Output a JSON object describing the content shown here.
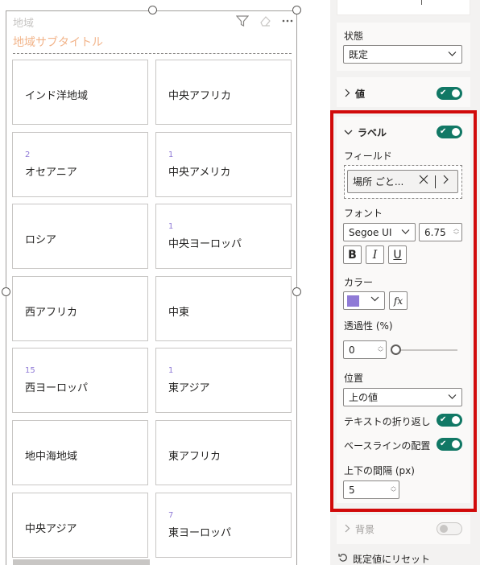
{
  "visual": {
    "title": "地域",
    "subtitle": "地域サブタイトル",
    "icons": [
      "filter-icon",
      "eraser-icon",
      "more-options-icon"
    ],
    "cards": [
      {
        "label": "インド洋地域",
        "value": ""
      },
      {
        "label": "中央アフリカ",
        "value": ""
      },
      {
        "label": "オセアニア",
        "value": "2"
      },
      {
        "label": "中央アメリカ",
        "value": "1"
      },
      {
        "label": "ロシア",
        "value": ""
      },
      {
        "label": "中央ヨーロッパ",
        "value": "1"
      },
      {
        "label": "西アフリカ",
        "value": ""
      },
      {
        "label": "中東",
        "value": ""
      },
      {
        "label": "西ヨーロッパ",
        "value": "15"
      },
      {
        "label": "東アジア",
        "value": "1"
      },
      {
        "label": "地中海地域",
        "value": ""
      },
      {
        "label": "東アフリカ",
        "value": ""
      },
      {
        "label": "中央アジア",
        "value": ""
      },
      {
        "label": "東ヨーロッパ",
        "value": "7"
      }
    ]
  },
  "panel": {
    "state_label": "状態",
    "state_value": "既定",
    "value_section": "値",
    "label_section": "ラベル",
    "field_label": "フィールド",
    "field_value": "場所 ごと...",
    "font_label": "フォント",
    "font_family": "Segoe UI",
    "font_size": "6.75",
    "bold": "B",
    "italic": "I",
    "underline": "U",
    "color_label": "カラー",
    "color_value": "#8f7ad6",
    "fx_label": "fx",
    "transparency_label": "透過性 (%)",
    "transparency_value": "0",
    "position_label": "位置",
    "position_value": "上の値",
    "wrap_label": "テキストの折り返し",
    "baseline_label": "ベースラインの配置",
    "spacing_label": "上下の間隔 (px)",
    "spacing_value": "5",
    "background_section": "背景",
    "reset_label": "既定値にリセット"
  }
}
